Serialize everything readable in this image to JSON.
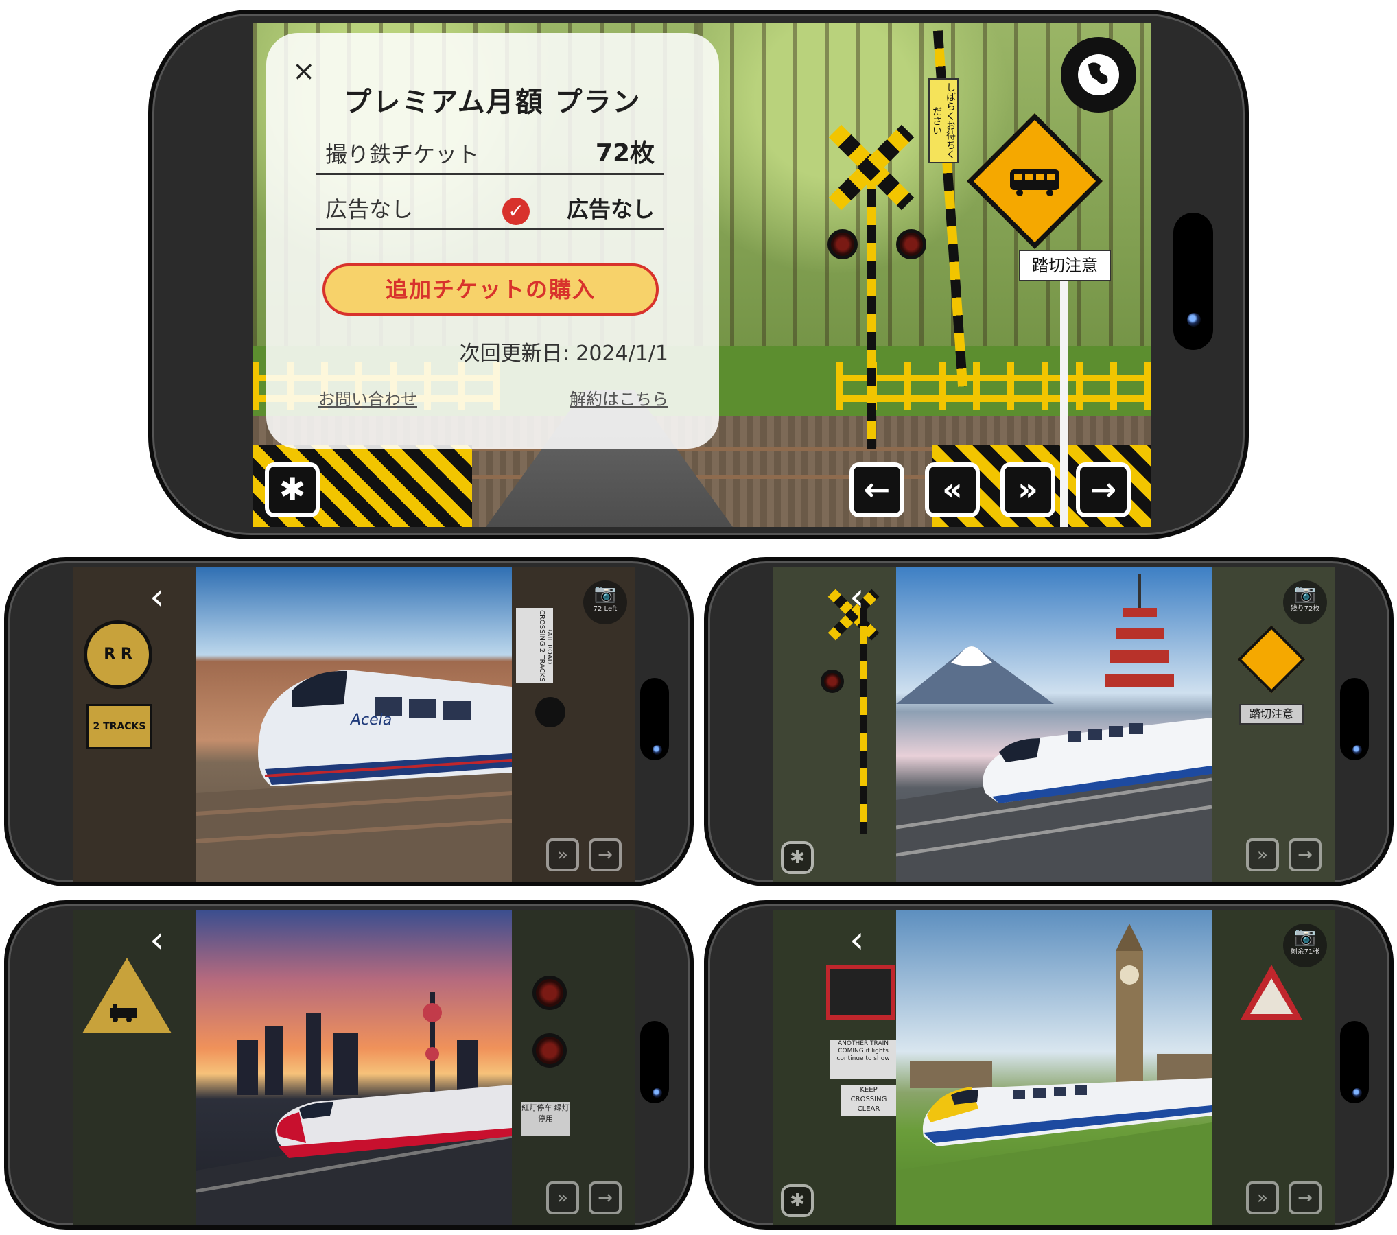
{
  "main_phone": {
    "modal": {
      "close_icon": "×",
      "title": "プレミアム月額 プラン",
      "ticket_label": "撮り鉄チケット",
      "ticket_value": "72枚",
      "ads_label": "広告なし",
      "ads_value": "広告なし",
      "check_icon": "✓",
      "buy_button": "追加チケットの購入",
      "renewal": "次回更新日: 2024/1/1",
      "contact_link": "お問い合わせ",
      "cancel_link": "解約はこちら"
    },
    "scene": {
      "crossing_plate": "踏切注意",
      "banner_text": "しばらくお待ちください"
    },
    "buttons": {
      "settings": "✱",
      "prev": "←",
      "rewind": "«",
      "forward": "»",
      "next": "→"
    }
  },
  "previews": [
    {
      "theme": "Grand Canyon Acela",
      "back": "‹",
      "badge": "72 Left",
      "sign_main": "R R",
      "sign_sub": "2 TRACKS",
      "right_sign": "RAIL ROAD CROSSING 2 TRACKS",
      "train_logo": "Acela",
      "colors": {
        "sky_top": "#2f6fb3",
        "sky_bottom": "#bcd7ec",
        "ground": "#b07b5a",
        "train": "#e8ecf2",
        "stripe": "#1f3a7a"
      }
    },
    {
      "theme": "Mt Fuji Shinkansen",
      "back": "‹",
      "badge": "残り72枚",
      "sign_main": "",
      "sign_sub": "踏切注意",
      "train_logo": "",
      "colors": {
        "sky_top": "#3d7fc4",
        "sky_bottom": "#cfe0ef",
        "ground": "#e8d0d8",
        "train": "#f3f5f8",
        "stripe": "#1d4aa0"
      }
    },
    {
      "theme": "Shanghai Sunset",
      "back": "‹",
      "badge": "",
      "sign_main": "",
      "sign_sub": "",
      "right_sign": "紅灯停车 绿灯停用",
      "train_logo": "",
      "colors": {
        "sky_top": "#3a4e8f",
        "sky_bottom": "#f0925a",
        "ground": "#2c2f3a",
        "train": "#e6e6ea",
        "stripe": "#c8102e"
      }
    },
    {
      "theme": "London Big Ben",
      "back": "‹",
      "badge": "剩余71张",
      "sign_main": "ANOTHER TRAIN COMING if lights continue to show",
      "sign_sub": "KEEP CROSSING CLEAR",
      "train_logo": "",
      "colors": {
        "sky_top": "#5d8fbf",
        "sky_bottom": "#d9e6ef",
        "ground": "#6a9d3a",
        "train": "#f0f2f5",
        "stripe": "#f1c40f"
      }
    }
  ]
}
